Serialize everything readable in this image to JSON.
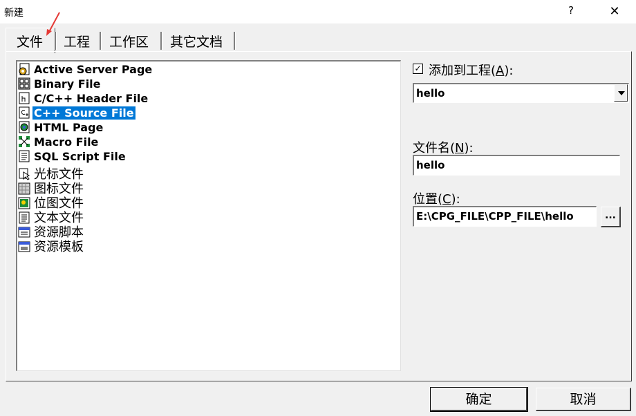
{
  "window": {
    "title": "新建",
    "help_label": "?",
    "close_label": "✕"
  },
  "tabs": [
    {
      "label": "文件",
      "active": true
    },
    {
      "label": "工程",
      "active": false
    },
    {
      "label": "工作区",
      "active": false
    },
    {
      "label": "其它文档",
      "active": false
    }
  ],
  "file_types": [
    {
      "label": "Active Server Page",
      "icon": "asp-icon",
      "selected": false
    },
    {
      "label": "Binary File",
      "icon": "binary-file-icon",
      "selected": false
    },
    {
      "label": "C/C++ Header File",
      "icon": "header-file-icon",
      "selected": false
    },
    {
      "label": "C++ Source File",
      "icon": "cpp-source-icon",
      "selected": true
    },
    {
      "label": "HTML Page",
      "icon": "html-page-icon",
      "selected": false
    },
    {
      "label": "Macro File",
      "icon": "macro-file-icon",
      "selected": false
    },
    {
      "label": "SQL Script File",
      "icon": "sql-script-icon",
      "selected": false
    },
    {
      "label": "光标文件",
      "icon": "cursor-file-icon",
      "selected": false
    },
    {
      "label": "图标文件",
      "icon": "icon-file-icon",
      "selected": false
    },
    {
      "label": "位图文件",
      "icon": "bitmap-file-icon",
      "selected": false
    },
    {
      "label": "文本文件",
      "icon": "text-file-icon",
      "selected": false
    },
    {
      "label": "资源脚本",
      "icon": "resource-script-icon",
      "selected": false
    },
    {
      "label": "资源模板",
      "icon": "resource-template-icon",
      "selected": false
    }
  ],
  "add_to_project": {
    "label_pre": "添加到工程(",
    "accel": "A",
    "label_post": "):",
    "checked": true,
    "check_mark": "✓"
  },
  "project_select": {
    "value": "hello"
  },
  "filename": {
    "label_pre": "文件名(",
    "accel": "N",
    "label_post": "):",
    "value": "hello"
  },
  "location": {
    "label_pre": "位置(",
    "accel": "C",
    "label_post": "):",
    "value": "E:\\CPG_FILE\\CPP_FILE\\hello",
    "browse_label": "..."
  },
  "buttons": {
    "ok": "确定",
    "cancel": "取消"
  },
  "colors": {
    "selection": "#0078d7",
    "annotation_arrow": "#e53935"
  }
}
